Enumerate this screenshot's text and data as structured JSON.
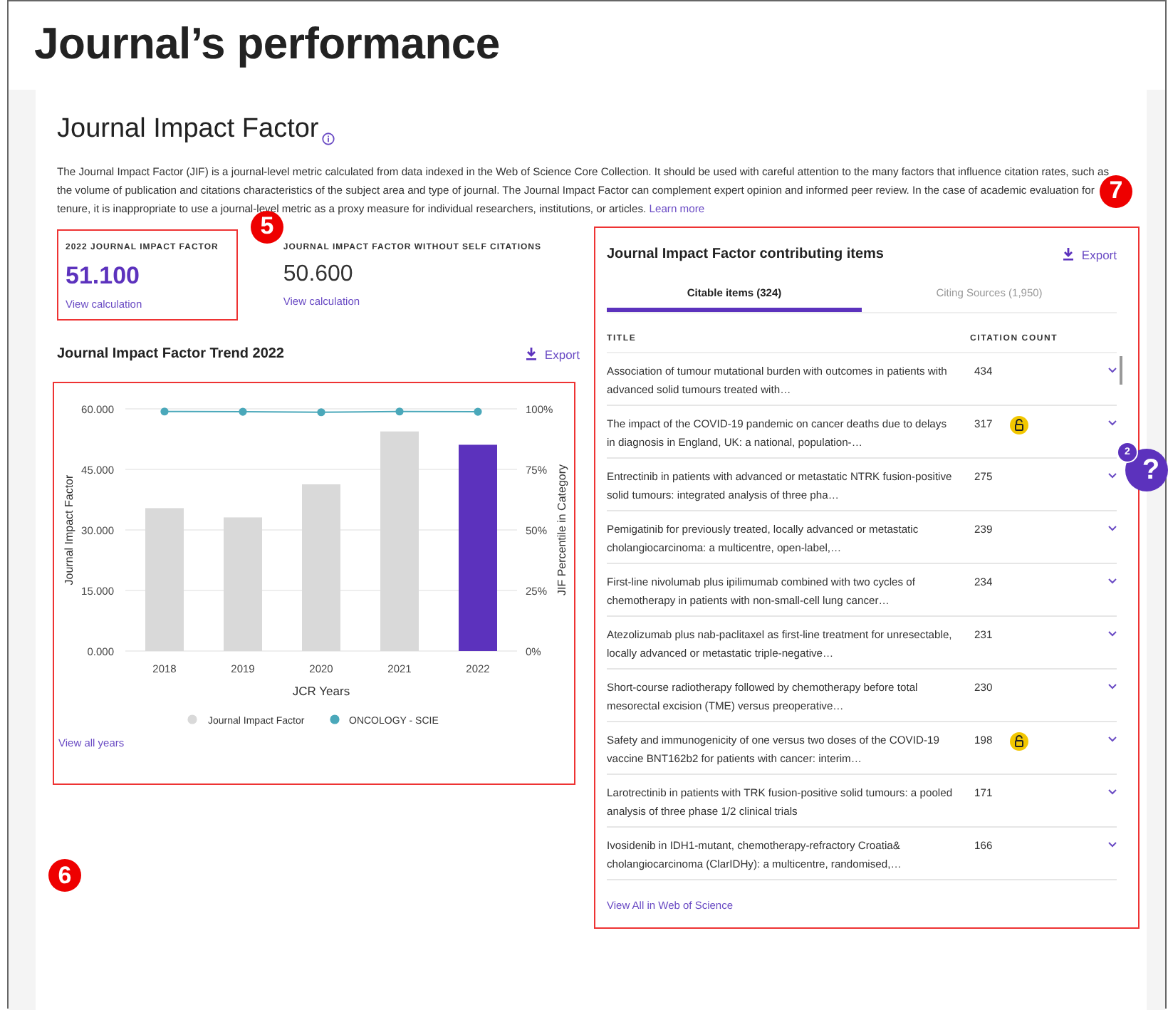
{
  "page_title": "Journal’s performance",
  "section": {
    "title": "Journal Impact Factor",
    "description": "The Journal Impact Factor (JIF) is a journal-level metric calculated from data indexed in the Web of Science Core Collection. It should be used with careful attention to the many factors that influence citation rates, such as the volume of publication and citations characteristics of the subject area and type of journal. The Journal Impact Factor can complement expert opinion and informed peer review. In the case of academic evaluation for tenure, it is inappropriate to use a journal-level metric as a proxy measure for individual researchers, institutions, or articles.",
    "learn_more": "Learn more"
  },
  "metrics": [
    {
      "label": "2022 JOURNAL IMPACT FACTOR",
      "value": "51.100",
      "link": "View calculation",
      "highlighted": true,
      "callout": "5"
    },
    {
      "label": "JOURNAL IMPACT FACTOR WITHOUT SELF CITATIONS",
      "value": "50.600",
      "link": "View calculation",
      "highlighted": false
    }
  ],
  "trend": {
    "title": "Journal Impact Factor Trend 2022",
    "export": "Export",
    "highlighted": true,
    "callout": "6",
    "view_all": "View all years",
    "chart_data": {
      "type": "bar",
      "xlabel": "JCR Years",
      "ylabel": "Journal Impact Factor",
      "categories": [
        "2018",
        "2019",
        "2020",
        "2021",
        "2022"
      ],
      "stacked": true,
      "grid": true,
      "series": [
        {
          "name": "Journal Impact Factor",
          "color": "#d9d9d9",
          "values": [
            35.4,
            33.1,
            41.3,
            54.4,
            null
          ]
        },
        {
          "color": "#5c32bd",
          "values": [
            null,
            null,
            null,
            null,
            51.1
          ]
        }
      ],
      "ylim": [
        0,
        60
      ],
      "yticks": [
        {
          "value": 0,
          "label": "0.000"
        },
        {
          "value": 15,
          "label": "15.000"
        },
        {
          "value": 30,
          "label": "30.000"
        },
        {
          "value": 45,
          "label": "45.000"
        },
        {
          "value": 60,
          "label": "60.000"
        }
      ]
    },
    "percentile": {
      "chart_data": {
        "type": "line",
        "ylabel": "JIF Percentile in Category",
        "series": [
          {
            "name": "ONCOLOGY - SCIE",
            "color": "#4aa8ba",
            "marker": true,
            "values": [
              98.9,
              98.8,
              98.6,
              98.9,
              98.8
            ]
          }
        ],
        "ylim": [
          0,
          100
        ],
        "yticks": [
          {
            "value": 0,
            "label": "0%"
          },
          {
            "value": 25,
            "label": "25%"
          },
          {
            "value": 50,
            "label": "50%"
          },
          {
            "value": 75,
            "label": "75%"
          },
          {
            "value": 100,
            "label": "100%"
          }
        ]
      }
    }
  },
  "contributing": {
    "title": "Journal Impact Factor contributing items",
    "export": "Export",
    "highlighted": true,
    "callout": "7",
    "tabs": [
      {
        "label": "Citable items (324)",
        "selected": true
      },
      {
        "label": "Citing Sources (1,950)",
        "selected": false
      }
    ],
    "columns": [
      "TITLE",
      "CITATION COUNT"
    ],
    "rows": [
      {
        "title": "Association of tumour mutational burden with outcomes in patients with advanced solid tumours treated with…",
        "count": "434",
        "open_access": false
      },
      {
        "title": "The impact of the COVID-19 pandemic on cancer deaths due to delays in diagnosis in England, UK: a national, population-…",
        "count": "317",
        "open_access": true
      },
      {
        "title": "Entrectinib in patients with advanced or metastatic NTRK fusion-positive solid tumours: integrated analysis of three pha…",
        "count": "275",
        "open_access": false
      },
      {
        "title": "Pemigatinib for previously treated, locally advanced or metastatic cholangiocarcinoma: a multicentre, open-label,…",
        "count": "239",
        "open_access": false
      },
      {
        "title": "First-line nivolumab plus ipilimumab combined with two cycles of chemotherapy in patients with non-small-cell lung cancer…",
        "count": "234",
        "open_access": false
      },
      {
        "title": "Atezolizumab plus nab-paclitaxel as first-line treatment for unresectable, locally advanced or metastatic triple-negative…",
        "count": "231",
        "open_access": false
      },
      {
        "title": "Short-course radiotherapy followed by chemotherapy before total mesorectal excision (TME) versus preoperative…",
        "count": "230",
        "open_access": false
      },
      {
        "title": "Safety and immunogenicity of one versus two doses of the COVID-19 vaccine BNT162b2 for patients with cancer: interim…",
        "count": "198",
        "open_access": true
      },
      {
        "title": "Larotrectinib in patients with TRK fusion-positive solid tumours: a pooled analysis of three phase 1/2 clinical trials",
        "count": "171",
        "open_access": false
      },
      {
        "title": "Ivosidenib in IDH1-mutant, chemotherapy-refractory Croatia& cholangiocarcinoma (ClarIDHy): a multicentre, randomised,…",
        "count": "166",
        "open_access": false
      }
    ],
    "view_all": "View All in Web of Science"
  },
  "help": {
    "badge": "2",
    "label": "?"
  }
}
